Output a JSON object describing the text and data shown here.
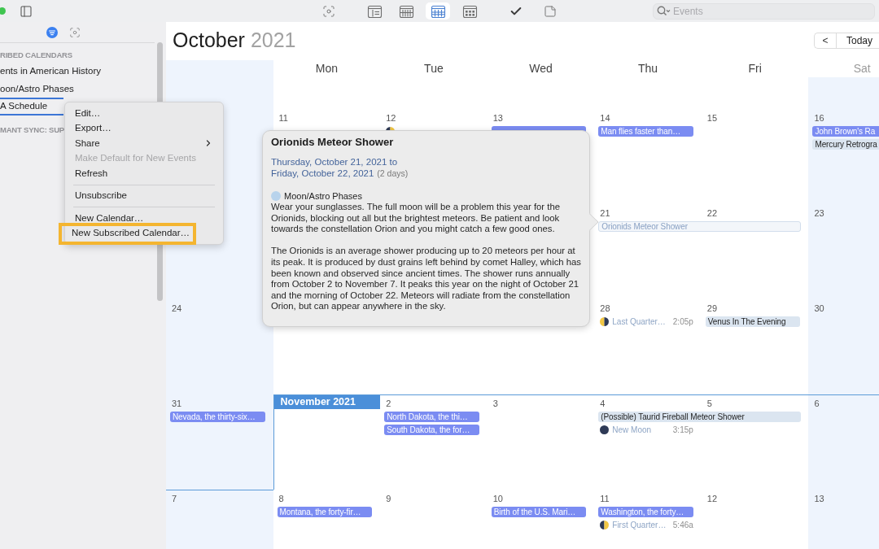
{
  "toolbar": {
    "view_buttons": [
      {
        "kind": "day",
        "selected": false
      },
      {
        "kind": "week",
        "selected": false
      },
      {
        "kind": "month",
        "selected": true
      },
      {
        "kind": "year",
        "selected": false
      }
    ],
    "search": {
      "placeholder": "Events"
    }
  },
  "sidebar": {
    "sections": [
      {
        "header": "RIBED CALENDARS",
        "calendars": [
          {
            "name": "ents in American History",
            "selected": false
          },
          {
            "name": "oon/Astro Phases",
            "selected": false
          },
          {
            "name": "A Schedule",
            "selected": true
          }
        ]
      },
      {
        "header": "MANT SYNC: SUP"
      }
    ]
  },
  "context_menu": {
    "items": [
      {
        "kind": "item",
        "label": "Edit…",
        "disabled": false,
        "submenu": false,
        "highlighted": false
      },
      {
        "kind": "item",
        "label": "Export…",
        "disabled": false,
        "submenu": false,
        "highlighted": false
      },
      {
        "kind": "item",
        "label": "Share",
        "disabled": false,
        "submenu": true,
        "highlighted": false
      },
      {
        "kind": "item",
        "label": "Make Default for New Events",
        "disabled": true,
        "submenu": false,
        "highlighted": false
      },
      {
        "kind": "item",
        "label": "Refresh",
        "disabled": false,
        "submenu": false,
        "highlighted": false
      },
      {
        "kind": "separator"
      },
      {
        "kind": "item",
        "label": "Unsubscribe",
        "disabled": false,
        "submenu": false,
        "highlighted": false
      },
      {
        "kind": "separator"
      },
      {
        "kind": "item",
        "label": "New Calendar…",
        "disabled": false,
        "submenu": false,
        "highlighted": false
      },
      {
        "kind": "item",
        "label": "New Subscribed Calendar…",
        "disabled": false,
        "submenu": false,
        "highlighted": true
      }
    ]
  },
  "calendar": {
    "month": "October",
    "year": "2021",
    "nav": {
      "previous": "<",
      "today": "Today"
    },
    "weekdays": [
      {
        "weekend": true
      },
      {
        "label": "Mon",
        "weekend": false
      },
      {
        "label": "Tue",
        "weekend": false
      },
      {
        "label": "Wed",
        "weekend": false
      },
      {
        "label": "Thu",
        "weekend": false
      },
      {
        "label": "Fri",
        "weekend": false
      },
      {
        "label": "Sat",
        "weekend": true
      }
    ],
    "weeks": [
      {
        "partial": true
      },
      {
        "partial": false,
        "days": {
          "mon": {
            "number": "11"
          },
          "tue": {
            "number": "12",
            "events": [
              {
                "kind": "first_quarter",
                "selected": false
              }
            ]
          },
          "wed": {
            "number": "13",
            "events": [
              {
                "kind": "bar",
                "color": "#7b8cf2",
                "selected": false
              }
            ]
          },
          "thu": {
            "number": "14",
            "events": [
              {
                "kind": "bar",
                "title": "Man flies faster than…",
                "color": "#7b8cf2",
                "selected": false
              }
            ]
          },
          "fri": {
            "number": "15"
          },
          "sat": {
            "number": "16",
            "events": [
              {
                "kind": "bar",
                "title": "John Brown's Ra",
                "color": "#7b8cf2",
                "selected": false
              },
              {
                "kind": "allday",
                "title": "Mercury Retrogra",
                "color": "#dbe5f0",
                "selected": false
              }
            ]
          }
        }
      },
      {
        "partial": false,
        "days": {
          "thu": {
            "number": "21",
            "events": [
              {
                "kind": "allday",
                "title": "Orionids Meteor Shower",
                "color": "#d2deec",
                "selected": true,
                "spans_next": true
              }
            ]
          },
          "fri": {
            "number": "22"
          },
          "sat": {
            "number": "23"
          }
        }
      },
      {
        "partial": false,
        "days": {
          "sun": {
            "number": "24"
          },
          "thu": {
            "number": "28",
            "events": [
              {
                "kind": "last_quarter",
                "title": "Last Quarter…",
                "time": "2:05p",
                "selected": false
              }
            ]
          },
          "fri": {
            "number": "29",
            "events": [
              {
                "kind": "allday",
                "title": "Venus In The Evening",
                "color": "#dbe5f0",
                "selected": false,
                "spans_next": false
              }
            ]
          },
          "sat": {
            "number": "30"
          }
        }
      },
      {
        "partial": false,
        "days": {
          "sun": {
            "number": "31",
            "events": [
              {
                "kind": "bar",
                "title": "Nevada, the thirty-six…",
                "color": "#7b8cf2",
                "selected": false
              }
            ]
          },
          "mon": {
            "month_label": "November 2021"
          },
          "tue": {
            "number": "2",
            "events": [
              {
                "kind": "bar",
                "title": "North Dakota, the thi…",
                "color": "#7b8cf2",
                "selected": false
              },
              {
                "kind": "bar",
                "title": "South Dakota, the for…",
                "color": "#7b8cf2",
                "selected": false
              }
            ]
          },
          "wed": {
            "number": "3"
          },
          "thu": {
            "number": "4",
            "events": [
              {
                "kind": "allday",
                "title": "(Possible) Taurid Fireball Meteor Shower",
                "color": "#dbe5f0",
                "selected": false,
                "spans_next": true
              },
              {
                "kind": "new_moon",
                "title": "New Moon",
                "time": "3:15p",
                "selected": false
              }
            ]
          },
          "fri": {
            "number": "5"
          },
          "sat": {
            "number": "6"
          }
        }
      },
      {
        "partial": false,
        "days": {
          "sun": {
            "number": "7"
          },
          "mon": {
            "number": "8",
            "events": [
              {
                "kind": "bar",
                "title": "Montana, the forty-fir…",
                "color": "#7b8cf2",
                "selected": false
              }
            ]
          },
          "tue": {
            "number": "9"
          },
          "wed": {
            "number": "10",
            "events": [
              {
                "kind": "bar",
                "title": "Birth of the U.S. Mari…",
                "color": "#7b8cf2",
                "selected": false
              }
            ]
          },
          "thu": {
            "number": "11",
            "events": [
              {
                "kind": "bar",
                "title": "Washington, the forty…",
                "color": "#7b8cf2",
                "selected": false
              },
              {
                "kind": "first_quarter",
                "title": "First Quarter…",
                "time": "5:46a",
                "selected": false
              }
            ]
          },
          "fri": {
            "number": "12"
          },
          "sat": {
            "number": "13"
          }
        }
      }
    ]
  },
  "popover": {
    "title": "Orionids Meteor Shower",
    "dates": [
      "Thursday, October 21, 2021 to",
      "Friday, October 22, 2021"
    ],
    "duration": "(2 days)",
    "calendar": {
      "name": "Moon/Astro Phases",
      "color": "#b8d3ec"
    },
    "notes": [
      "Wear your sunglasses. The full moon will be a problem this year for the Orionids, blocking out all but the brightest meteors. Be patient and look towards the constellation Orion and you might catch a few good ones.",
      "The Orionids is an average shower producing up to 20 meteors per hour at its peak. It is produced by dust grains left behind by comet Halley, which has been known and observed since ancient times. The shower runs annually from October 2 to November 7. It peaks this year on the night of October 21 and the morning of October 22. Meteors will radiate from the constellation Orion, but can appear anywhere in the sky."
    ]
  }
}
